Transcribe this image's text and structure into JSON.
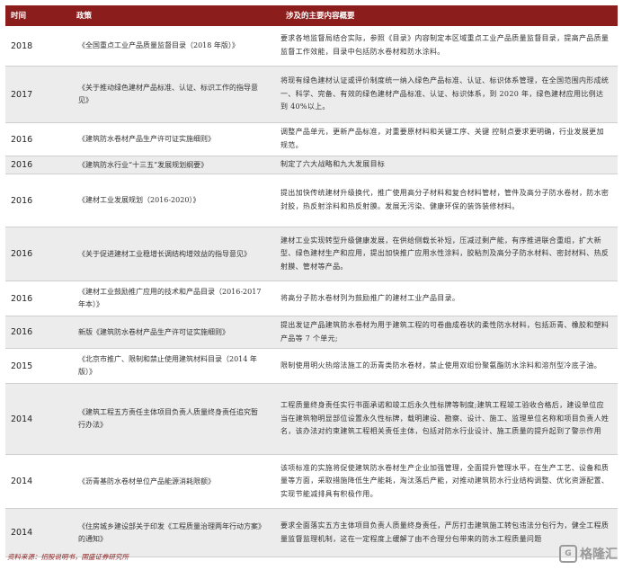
{
  "header": {
    "col1": "时间",
    "col2": "政策",
    "col3": "涉及的主要内容概要"
  },
  "rows": [
    {
      "year": "2018",
      "policy": "《全国重点工业产品质量监督目录（2018 年版）》",
      "content": "要求各地监督局结合实际，参照《目录》内容制定本区域重点工业产品质量监督目录，提高产品质量监督工作效能，目录中包括防水卷材和防水涂料。"
    },
    {
      "year": "2017",
      "policy": "《关于推动绿色建材产品标准、认证、标识工作的指导意见》",
      "content": "将现有绿色建材认证或评价制度统一纳入绿色产品标准、认证、标识体系管理，在全国范围内形成统一、科学、完备、有效的绿色建材产品标准、认证、标识体系，到 2020 年，绿色建材应用比例达到 40%以上。"
    },
    {
      "year": "2016",
      "policy": "《建筑防水卷材产品生产许可证实施细则》",
      "content": "调整产品单元，更新产品标准，对重要原材料和关键工序、关键 控制点要求更明确，行业发展更加规范。"
    },
    {
      "year": "2016",
      "policy": "《建筑防水行业“十三五”发展规划纲要》",
      "content": "制定了六大战略和九大发展目标"
    },
    {
      "year": "2016",
      "policy": "《建材工业发展规划（2016-2020）》",
      "content": "提出加快传统建材升级换代，推广使用高分子材料和复合材料管材，管件及高分子防水卷材，防水密封胶，热反射涂料和热反射膜。发展无污染、健康环保的装饰装修材料。"
    },
    {
      "year": "2016",
      "policy": "《关于促进建材工业稳增长调结构增效益的指导意见》",
      "content": "建材工业实现转型升级健康发展，在供给侧载长补短，压减过剩产能，有序推进联合重组，扩大新型、绿色建材生产和应用，提出加快推广应用水性涂料，胶粘剂及高分子防水材料、密封材料、热反射膜、管材等产品。"
    },
    {
      "year": "2016",
      "policy": "《建材工业鼓励推广应用的技术和产品目录（2016-2017 年本）》",
      "content": "将高分子防水卷材列为鼓励推广的建材工业产品目录。"
    },
    {
      "year": "2016",
      "policy": "新版《建筑防水卷材产品生产许可证实施细则》",
      "content": "提出发证产品建筑防水卷材为用于建筑工程的可卷曲成卷状的柔性防水材料，包括沥青、橡胶和塑料产品等 7 个单元;"
    },
    {
      "year": "2015",
      "policy": "《北京市推广、限制和禁止使用建筑材料目录（2014 年版）》",
      "content": "限制使用明火热熔法施工的沥青类防水卷材，禁止使用双组份聚氨酯防水涂料和溶剂型冷底子油。"
    },
    {
      "year": "2014",
      "policy": "《建筑工程五方责任主体项目负责人质量终身责任追究暂行办法》",
      "content": "工程质量终身责任实行书面承诺和竣工后永久性标牌等制度;建筑工程竣工验收合格后，建设单位应当在建筑物明显部位设置永久性标牌，载明建设、勘察、设计、施工、监理单位名称和项目负责人姓名，该办法对约束建筑工程相关责任主体，包括对防水行业设计、施工质量的提升起到了警示作用"
    },
    {
      "year": "2014",
      "policy": "《沥青基防水卷材单位产品能源消耗限额》",
      "content": "该项标准的实施将促使建筑防水卷材生产企业加强管理，全面提升管理水平，在生产工艺、设备和质量等方面，采取措施降低生产能耗，淘汰落后产能，对推动建筑防水行业结构调整、优化资源配置、实现节能减排具有积极作用。"
    },
    {
      "year": "2014",
      "policy": "《住房城乡建设部关于印发《工程质量治理两年行动方案》的通知》",
      "content": "要求全面落实五方主体项目负责人质量终身责任，严厉打击建筑施工转包违法分包行为，健全工程质量监督监理机制，这在一定程度上缓解了由不合理分包带来的防水工程质量问题"
    }
  ],
  "source": "资料来源：招股说明书，国盛证券研究所",
  "watermark": "格隆汇"
}
